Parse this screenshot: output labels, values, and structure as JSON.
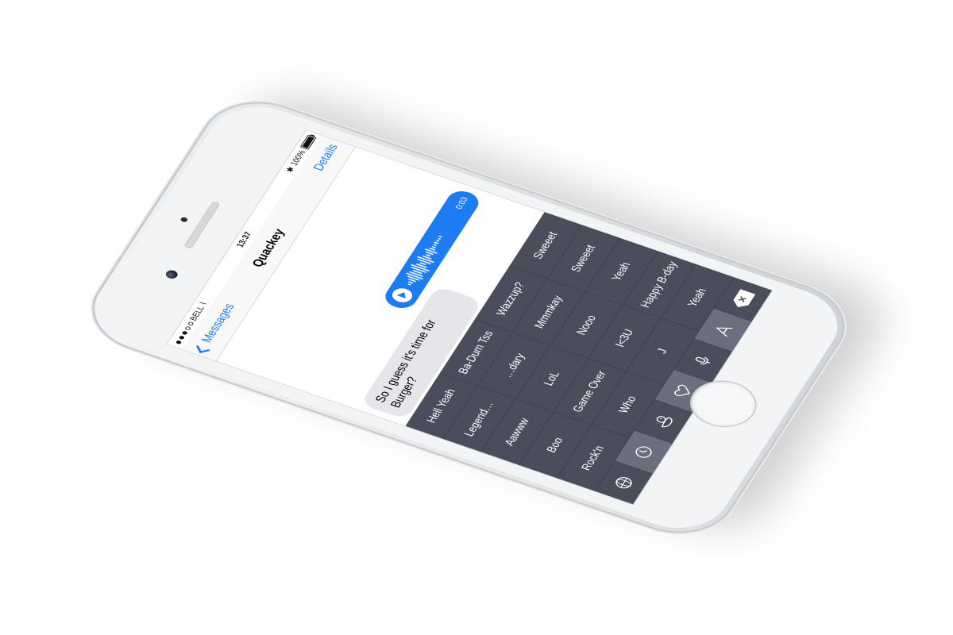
{
  "status_bar": {
    "carrier": "BELL",
    "time": "13:37",
    "battery": "100%"
  },
  "nav": {
    "back_label": "Messages",
    "title": "Quackey",
    "details_label": "Details"
  },
  "messages": {
    "incoming_text": "So I guess it's time for Burger?",
    "audio_duration": "0:03"
  },
  "keyboard": {
    "phrases": [
      "Hell Yeah",
      "Ba-Dum Tss",
      "Wazzup?",
      "Sweeet",
      "Legend…",
      "…dary",
      "Mmmkay",
      "Sweeet",
      "Aawww",
      "LoL",
      "Nooo",
      "Yeah",
      "Boo",
      "Game Over",
      "I<3U",
      "Happy B-day",
      "Rock'n",
      "Who",
      "J",
      "Yeah"
    ],
    "bottom_icons": [
      "globe-icon",
      "clock-icon",
      "duck-icon",
      "heart-icon",
      "microphone-icon",
      "font-icon",
      "delete-icon"
    ]
  },
  "colors": {
    "accent": "#1d7cf2",
    "keyboard_bg": "#4a4e5c",
    "incoming_bubble": "#e5e5ea"
  }
}
